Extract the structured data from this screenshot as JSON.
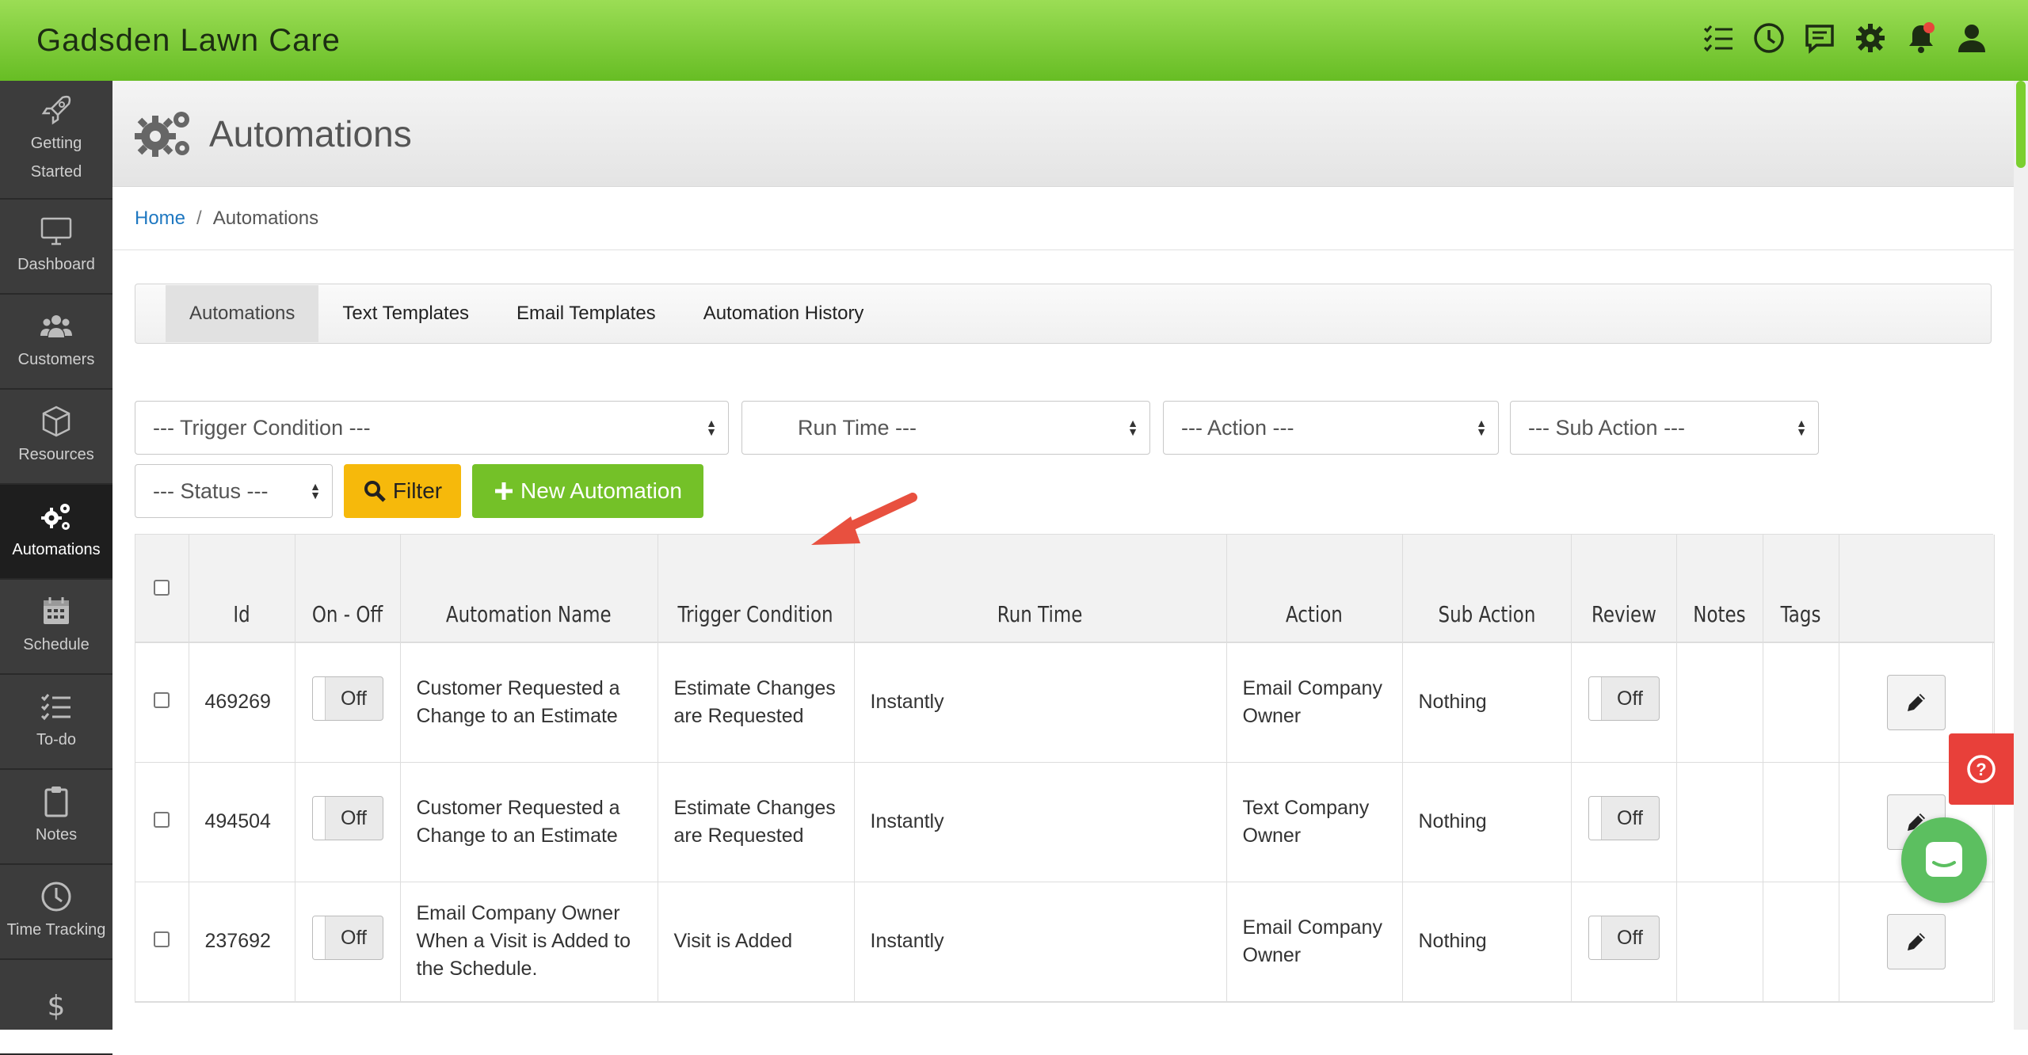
{
  "app": {
    "title": "Gadsden Lawn Care"
  },
  "top_icons": [
    "checklist-icon",
    "clock-icon",
    "chat-icon",
    "gear-icon",
    "bell-icon",
    "user-icon"
  ],
  "sidebar": {
    "items": [
      {
        "label": "Getting Started",
        "icon": "rocket-icon"
      },
      {
        "label": "Dashboard",
        "icon": "monitor-icon"
      },
      {
        "label": "Customers",
        "icon": "users-icon"
      },
      {
        "label": "Resources",
        "icon": "box-icon"
      },
      {
        "label": "Automations",
        "icon": "gears-icon",
        "active": true
      },
      {
        "label": "Schedule",
        "icon": "calendar-icon"
      },
      {
        "label": "To-do",
        "icon": "checklist-icon"
      },
      {
        "label": "Notes",
        "icon": "clipboard-icon"
      },
      {
        "label": "Time Tracking",
        "icon": "clock-icon"
      },
      {
        "label": "",
        "icon": "dollar-icon"
      }
    ]
  },
  "page": {
    "title": "Automations"
  },
  "breadcrumb": {
    "home": "Home",
    "separator": "/",
    "current": "Automations"
  },
  "tabs": [
    "Automations",
    "Text Templates",
    "Email Templates",
    "Automation History"
  ],
  "filters": {
    "trigger": "--- Trigger Condition ---",
    "run_time": "--- Run Time ---",
    "run_time_visible": "Run Time ---",
    "action": "--- Action ---",
    "sub_action": "--- Sub Action ---",
    "status": "--- Status ---",
    "filter_button": "Filter",
    "new_button": "New Automation"
  },
  "table": {
    "headers": [
      "Id",
      "On - Off",
      "Automation Name",
      "Trigger Condition",
      "Run Time",
      "Action",
      "Sub Action",
      "Review",
      "Notes",
      "Tags"
    ],
    "rows": [
      {
        "id": "469269",
        "onoff": "Off",
        "name": "Customer Requested a Change to an Estimate",
        "trigger": "Estimate Changes are Requested",
        "run_time": "Instantly",
        "action": "Email Company Owner",
        "sub_action": "Nothing",
        "review": "Off",
        "notes": "",
        "tags": ""
      },
      {
        "id": "494504",
        "onoff": "Off",
        "name": "Customer Requested a Change to an Estimate",
        "trigger": "Estimate Changes are Requested",
        "run_time": "Instantly",
        "action": "Text Company Owner",
        "sub_action": "Nothing",
        "review": "Off",
        "notes": "",
        "tags": ""
      },
      {
        "id": "237692",
        "onoff": "Off",
        "name": "Email Company Owner When a Visit is Added to the Schedule.",
        "trigger": "Visit is Added",
        "run_time": "Instantly",
        "action": "Email Company Owner",
        "sub_action": "Nothing",
        "review": "Off",
        "notes": "",
        "tags": ""
      }
    ]
  },
  "colors": {
    "topbar_green": "#7ccd35",
    "button_green": "#74c128",
    "button_yellow": "#f6b90b",
    "help_red": "#e8403a",
    "arrow_red": "#e8503f"
  }
}
